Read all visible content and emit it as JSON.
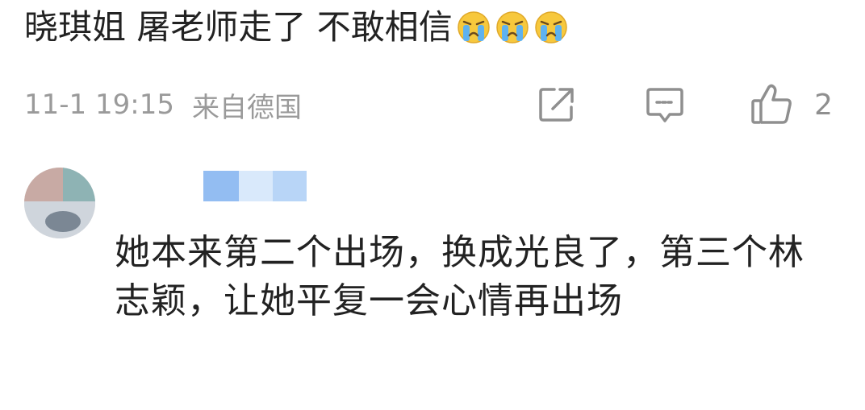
{
  "comment": {
    "text": "晓琪姐 屠老师走了 不敢相信",
    "emoji": [
      "crying-face-emoji",
      "crying-face-emoji",
      "crying-face-emoji"
    ],
    "timestamp": "11-1 19:15",
    "location": "来自德国"
  },
  "actions": {
    "share_icon": "share-icon",
    "reply_icon": "comment-icon",
    "like_icon": "thumbs-up-icon",
    "like_count": "2"
  },
  "reply": {
    "text": "她本来第二个出场，换成光良了，第三个林志颖，让她平复一会心情再出场"
  },
  "colors": {
    "text_primary": "#222222",
    "text_secondary": "#9a9a9a",
    "icon": "#8f8f8f",
    "emoji_face": "#f7c83d",
    "emoji_tears": "#5fb2f0"
  }
}
